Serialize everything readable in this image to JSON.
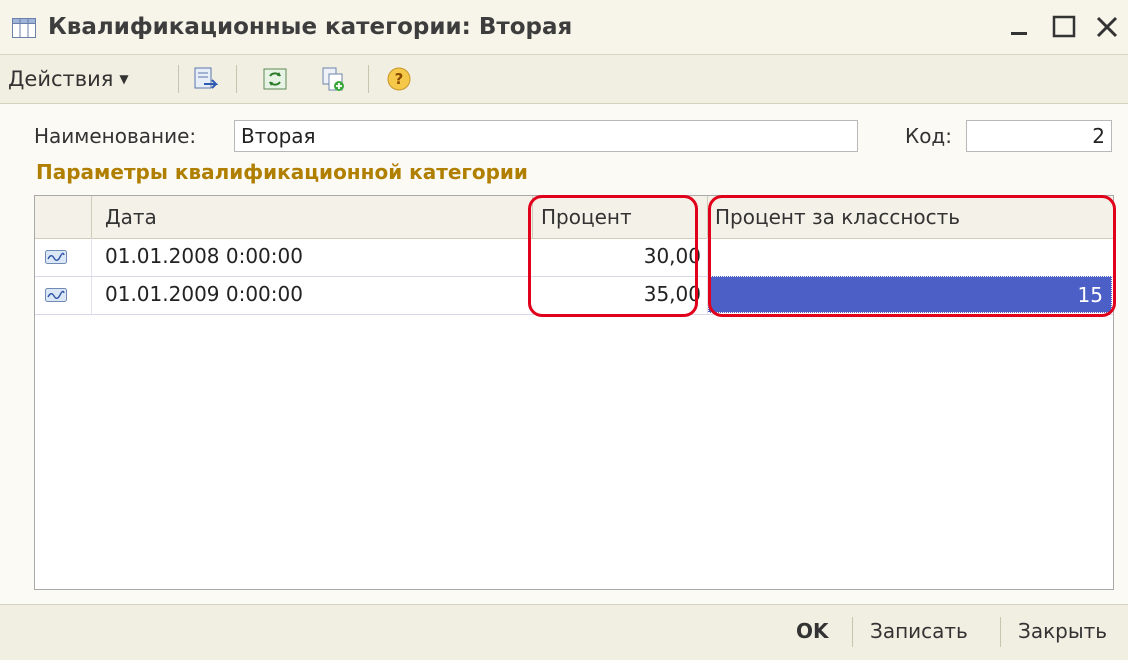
{
  "window": {
    "title": "Квалификационные категории: Вторая"
  },
  "toolbar": {
    "actions_label": "Действия"
  },
  "form": {
    "name_label": "Наименование:",
    "name_value": "Вторая",
    "code_label": "Код:",
    "code_value": "2",
    "section_title": "Параметры квалификационной категории"
  },
  "table": {
    "columns": [
      "Дата",
      "Процент",
      "Процент за классность"
    ],
    "rows": [
      {
        "date": "01.01.2008 0:00:00",
        "percent": "30,00",
        "class_percent": ""
      },
      {
        "date": "01.01.2009 0:00:00",
        "percent": "35,00",
        "class_percent": "15"
      }
    ]
  },
  "footer": {
    "ok_label": "OK",
    "save_label": "Записать",
    "close_label": "Закрыть"
  },
  "colors": {
    "section_title": "#b07f00",
    "selection": "#4b5fc6",
    "highlight": "#e0001b"
  }
}
